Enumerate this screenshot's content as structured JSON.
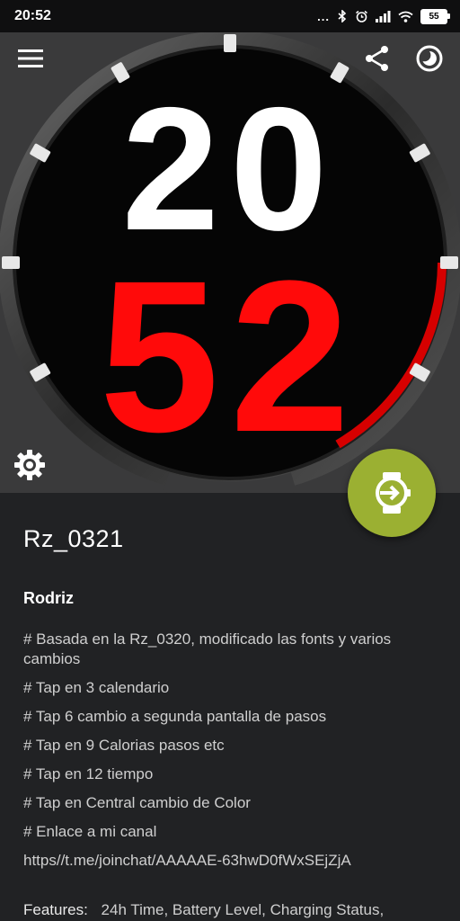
{
  "status_bar": {
    "time": "20:52",
    "dots": "...",
    "battery_level": "55",
    "icons": [
      "bluetooth-icon",
      "alarm-icon",
      "signal-icon",
      "wifi-icon",
      "battery-icon"
    ]
  },
  "toolbar": {
    "menu_icon": "menu-icon",
    "share_icon": "share-icon",
    "theme_icon": "theme-icon"
  },
  "watch_face": {
    "hours": "20",
    "minutes": "52",
    "hour_color": "#ffffff",
    "minute_color": "#ff0a0a",
    "ring_progress": 0.2
  },
  "fab": {
    "icon": "send-to-watch-icon",
    "color": "#9bb032"
  },
  "details": {
    "title": "Rz_0321",
    "author": "Rodriz",
    "description": [
      "# Basada en la Rz_0320, modificado las fonts y varios cambios",
      "# Tap en 3 calendario",
      "# Tap 6 cambio a segunda pantalla de pasos",
      "# Tap en 9 Calorias pasos etc",
      "# Tap en 12 tiempo",
      "# Tap en Central cambio de Color",
      "# Enlace a mi canal"
    ],
    "link": "https//t.me/joinchat/AAAAAE-63hwD0fWxSEjZjA",
    "features_label": "Features:",
    "features": "24h Time,  Battery Level,  Charging Status,"
  }
}
